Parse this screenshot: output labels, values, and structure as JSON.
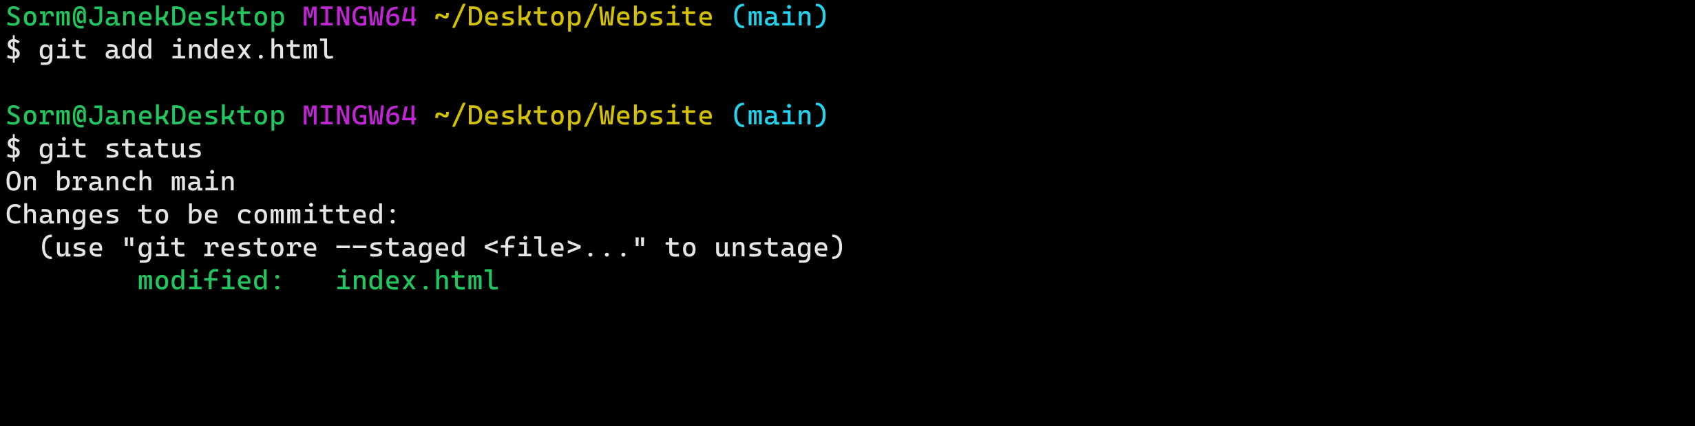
{
  "prompts": [
    {
      "user_host": "Sorm@JanekDesktop",
      "env": "MINGW64",
      "cwd": "~/Desktop/Website",
      "branch_open": "(",
      "branch": "main",
      "branch_close": ")",
      "ps": "$ ",
      "command": "git add index.html"
    },
    {
      "user_host": "Sorm@JanekDesktop",
      "env": "MINGW64",
      "cwd": "~/Desktop/Website",
      "branch_open": "(",
      "branch": "main",
      "branch_close": ")",
      "ps": "$ ",
      "command": "git status"
    }
  ],
  "status": {
    "line1": "On branch main",
    "line2": "Changes to be committed:",
    "line3": "  (use \"git restore --staged <file>...\" to unstage)",
    "staged_line": "        modified:   index.html"
  }
}
